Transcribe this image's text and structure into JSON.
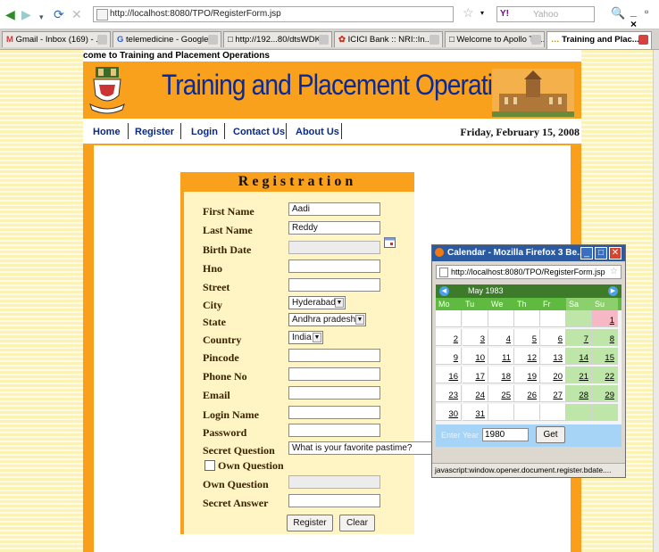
{
  "browser": {
    "url": "http://localhost:8080/TPO/RegisterForm.jsp",
    "search_engine": "Y!",
    "search_placeholder": "Yahoo",
    "window_controls": "_ ▫ ×"
  },
  "tabs": [
    {
      "label": "Gmail - Inbox (169) - ..."
    },
    {
      "label": "telemedicine - Google..."
    },
    {
      "label": "http://192...80/dtsWDK"
    },
    {
      "label": "ICICI Bank :: NRI::In..."
    },
    {
      "label": "Welcome to Apollo Te..."
    },
    {
      "label": "Training and Plac..."
    }
  ],
  "site": {
    "welcome": "come to Training and Placement Operations",
    "title": "Training and Placement Operations",
    "menu": [
      "Home",
      "Register",
      "Login",
      "Contact Us",
      "About Us"
    ],
    "date": "Friday, February 15, 2008"
  },
  "form": {
    "heading": "Registration",
    "labels": {
      "first_name": "First Name",
      "last_name": "Last Name",
      "birth_date": "Birth Date",
      "hno": "Hno",
      "street": "Street",
      "city": "City",
      "state": "State",
      "country": "Country",
      "pincode": "Pincode",
      "phone": "Phone No",
      "email": "Email",
      "login_name": "Login Name",
      "password": "Password",
      "secret_question": "Secret Question",
      "own_question_checkbox": "Own Question",
      "own_question": "Own Question",
      "secret_answer": "Secret Answer"
    },
    "values": {
      "first_name": "Aadi",
      "last_name": "Reddy",
      "city": "Hyderabad",
      "state": "Andhra pradesh",
      "country": "India",
      "secret_question": "What is your favorite pastime?"
    },
    "register_button": "Register",
    "clear_button": "Clear"
  },
  "popup": {
    "title": "Calendar - Mozilla Firefox 3 Be...",
    "url": "http://localhost:8080/TPO/RegisterForm.jsp",
    "status": "javascript:window.opener.document.register.bdate....",
    "calendar": {
      "month_label": "May 1983",
      "weekdays": [
        "Mo",
        "Tu",
        "We",
        "Th",
        "Fr",
        "Sa",
        "Su"
      ],
      "weeks": [
        [
          "",
          "",
          "",
          "",
          "",
          "",
          "1"
        ],
        [
          "2",
          "3",
          "4",
          "5",
          "6",
          "7",
          "8"
        ],
        [
          "9",
          "10",
          "11",
          "12",
          "13",
          "14",
          "15"
        ],
        [
          "16",
          "17",
          "18",
          "19",
          "20",
          "21",
          "22"
        ],
        [
          "23",
          "24",
          "25",
          "26",
          "27",
          "28",
          "29"
        ],
        [
          "30",
          "31",
          "",
          "",
          "",
          "",
          ""
        ]
      ],
      "year_label": "Enter Year",
      "year_value": "1980",
      "get_button": "Get"
    }
  },
  "colors": {
    "site_orange": "#f9a01c",
    "banner_text": "#0a2a99",
    "calendar_header": "#3d7a2a",
    "calendar_weekend": "#bfe6a9"
  }
}
